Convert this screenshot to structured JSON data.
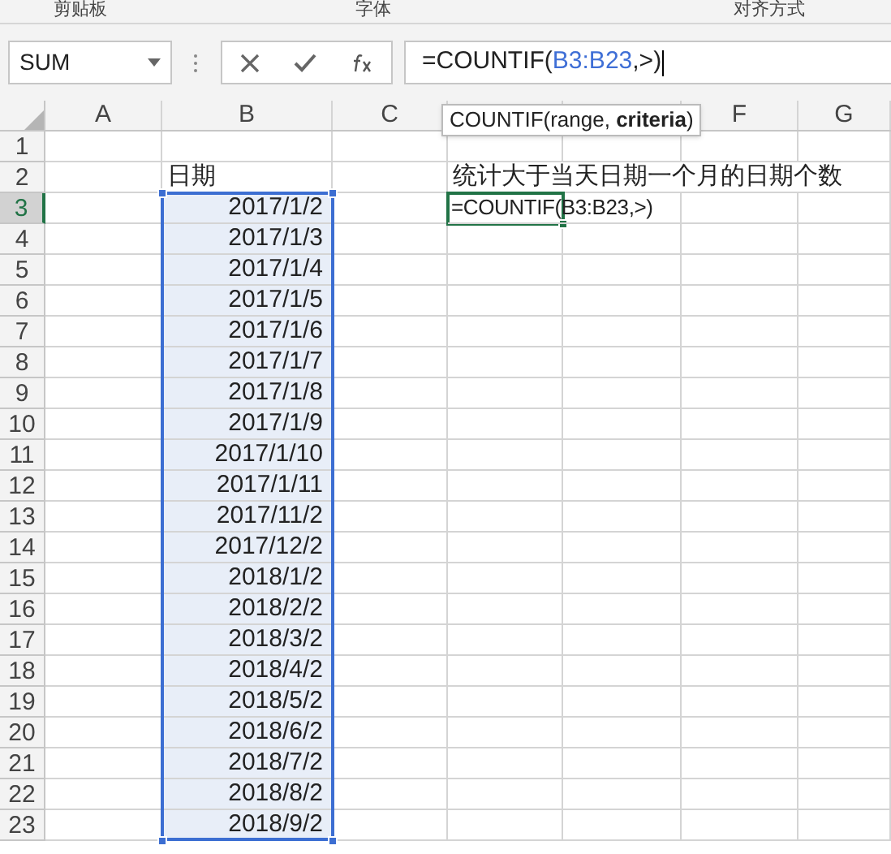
{
  "ribbon_groups": [
    "剪贴板",
    "字体",
    "对齐方式"
  ],
  "name_box": {
    "value": "SUM"
  },
  "formula_bar": {
    "parts": [
      {
        "kind": "plain",
        "text": "=COUNTIF("
      },
      {
        "kind": "range",
        "text": "B3:B23"
      },
      {
        "kind": "plain",
        "text": ",>)"
      }
    ]
  },
  "tooltip": "COUNTIF(range, **criteria**)",
  "columns": [
    {
      "label": "A"
    },
    {
      "label": "B"
    },
    {
      "label": "C"
    },
    {},
    {},
    {
      "label": "F"
    },
    {
      "label": "G"
    }
  ],
  "rows": [
    {
      "header": "1",
      "active": false,
      "in_selection": false
    },
    {
      "header": "2",
      "active": false,
      "in_selection": false,
      "B": "日期",
      "D": "统计大于当天日期一个月的日期个数"
    },
    {
      "header": "3",
      "active": true,
      "in_selection": true,
      "B": "2017/1/2",
      "D": "=COUNTIF(B3:B23,>)"
    },
    {
      "header": "4",
      "active": false,
      "in_selection": true,
      "B": "2017/1/3"
    },
    {
      "header": "5",
      "active": false,
      "in_selection": true,
      "B": "2017/1/4"
    },
    {
      "header": "6",
      "active": false,
      "in_selection": true,
      "B": "2017/1/5"
    },
    {
      "header": "7",
      "active": false,
      "in_selection": true,
      "B": "2017/1/6"
    },
    {
      "header": "8",
      "active": false,
      "in_selection": true,
      "B": "2017/1/7"
    },
    {
      "header": "9",
      "active": false,
      "in_selection": true,
      "B": "2017/1/8"
    },
    {
      "header": "10",
      "active": false,
      "in_selection": true,
      "B": "2017/1/9"
    },
    {
      "header": "11",
      "active": false,
      "in_selection": true,
      "B": "2017/1/10"
    },
    {
      "header": "12",
      "active": false,
      "in_selection": true,
      "B": "2017/1/11"
    },
    {
      "header": "13",
      "active": false,
      "in_selection": true,
      "B": "2017/11/2"
    },
    {
      "header": "14",
      "active": false,
      "in_selection": true,
      "B": "2017/12/2"
    },
    {
      "header": "15",
      "active": false,
      "in_selection": true,
      "B": "2018/1/2"
    },
    {
      "header": "16",
      "active": false,
      "in_selection": true,
      "B": "2018/2/2"
    },
    {
      "header": "17",
      "active": false,
      "in_selection": true,
      "B": "2018/3/2"
    },
    {
      "header": "18",
      "active": false,
      "in_selection": true,
      "B": "2018/4/2"
    },
    {
      "header": "19",
      "active": false,
      "in_selection": true,
      "B": "2018/5/2"
    },
    {
      "header": "20",
      "active": false,
      "in_selection": true,
      "B": "2018/6/2"
    },
    {
      "header": "21",
      "active": false,
      "in_selection": true,
      "B": "2018/7/2"
    },
    {
      "header": "22",
      "active": false,
      "in_selection": true,
      "B": "2018/8/2"
    },
    {
      "header": "23",
      "active": false,
      "in_selection": true,
      "B": "2018/9/2"
    }
  ]
}
